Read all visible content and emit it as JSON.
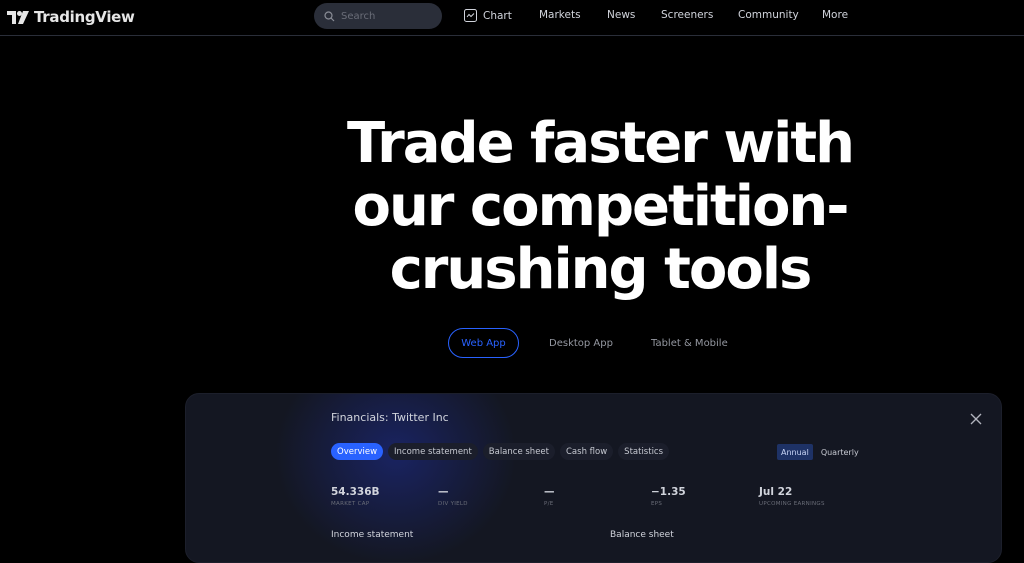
{
  "header": {
    "logo_text": "TradingView",
    "search": {
      "placeholder": "Search",
      "value": ""
    },
    "nav": [
      {
        "label": "Chart",
        "icon": "chart-icon"
      },
      {
        "label": "Markets"
      },
      {
        "label": "News"
      },
      {
        "label": "Screeners"
      },
      {
        "label": "Community"
      },
      {
        "label": "More"
      }
    ]
  },
  "hero": {
    "title_lines": [
      "Trade faster with",
      "our competition-",
      "crushing tools"
    ]
  },
  "app_tabs": [
    {
      "label": "Web App",
      "active": true
    },
    {
      "label": "Desktop App",
      "active": false
    },
    {
      "label": "Tablet & Mobile",
      "active": false
    }
  ],
  "financials": {
    "title": "Financials: Twitter Inc",
    "close_icon": "close-icon",
    "tabs": [
      {
        "label": "Overview",
        "active": true
      },
      {
        "label": "Income statement",
        "active": false
      },
      {
        "label": "Balance sheet",
        "active": false
      },
      {
        "label": "Cash flow",
        "active": false
      },
      {
        "label": "Statistics",
        "active": false
      }
    ],
    "period": [
      {
        "label": "Annual",
        "active": true
      },
      {
        "label": "Quarterly",
        "active": false
      }
    ],
    "stats": [
      {
        "value": "54.336B",
        "label": "MARKET CAP"
      },
      {
        "value": "—",
        "label": "DIV YIELD"
      },
      {
        "value": "—",
        "label": "P/E"
      },
      {
        "value": "−1.35",
        "label": "EPS"
      },
      {
        "value": "Jul 22",
        "label": "UPCOMING EARNINGS"
      }
    ],
    "sections": [
      "Income statement",
      "Balance sheet"
    ]
  },
  "colors": {
    "accent": "#2962ff",
    "background": "#000000",
    "panel": "#141722"
  }
}
